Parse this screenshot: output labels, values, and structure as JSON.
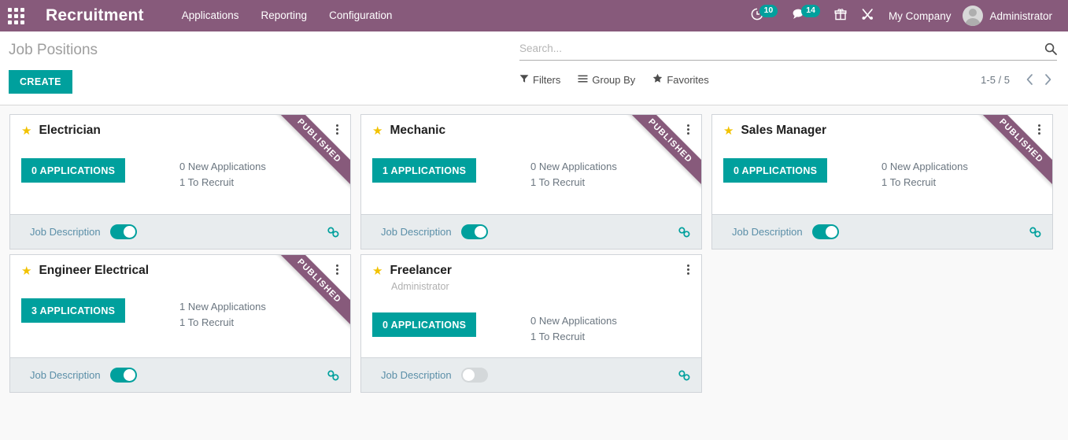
{
  "navbar": {
    "apps_icon": "apps-grid-icon",
    "brand": "Recruitment",
    "menu_items": [
      {
        "label": "Applications"
      },
      {
        "label": "Reporting"
      },
      {
        "label": "Configuration"
      }
    ],
    "systray": {
      "activities": {
        "icon": "clock-icon",
        "count": "10"
      },
      "messages": {
        "icon": "chat-bubble-icon",
        "count": "14"
      },
      "gift": {
        "icon": "gift-icon"
      },
      "tools": {
        "icon": "wrench-screwdriver-icon"
      },
      "company": "My Company",
      "user": "Administrator"
    }
  },
  "control_panel": {
    "breadcrumb": "Job Positions",
    "create_label": "CREATE",
    "search": {
      "placeholder": "Search...",
      "value": "",
      "icon": "search-icon"
    },
    "filters": [
      {
        "label": "Filters",
        "icon": "filter-icon"
      },
      {
        "label": "Group By",
        "icon": "list-icon"
      },
      {
        "label": "Favorites",
        "icon": "star-icon"
      }
    ],
    "pager": {
      "count": "1-5 / 5",
      "prev_icon": "chevron-left-icon",
      "next_icon": "chevron-right-icon"
    }
  },
  "kanban": {
    "ribbon_label": "PUBLISHED",
    "footer_toggle_label": "Job Description",
    "cards": [
      {
        "title": "Electrician",
        "subtitle": "",
        "starred": true,
        "published": true,
        "applications_button": "0 APPLICATIONS",
        "new_applications": "0 New Applications",
        "to_recruit": "1 To Recruit",
        "job_description_on": true
      },
      {
        "title": "Mechanic",
        "subtitle": "",
        "starred": true,
        "published": true,
        "applications_button": "1 APPLICATIONS",
        "new_applications": "0 New Applications",
        "to_recruit": "1 To Recruit",
        "job_description_on": true
      },
      {
        "title": "Sales Manager",
        "subtitle": "",
        "starred": true,
        "published": true,
        "applications_button": "0 APPLICATIONS",
        "new_applications": "0 New Applications",
        "to_recruit": "1 To Recruit",
        "job_description_on": true
      },
      {
        "title": "Engineer Electrical",
        "subtitle": "",
        "starred": true,
        "published": true,
        "applications_button": "3 APPLICATIONS",
        "new_applications": "1 New Applications",
        "to_recruit": "1 To Recruit",
        "job_description_on": true
      },
      {
        "title": "Freelancer",
        "subtitle": "Administrator",
        "starred": true,
        "published": false,
        "applications_button": "0 APPLICATIONS",
        "new_applications": "0 New Applications",
        "to_recruit": "1 To Recruit",
        "job_description_on": false
      }
    ]
  },
  "colors": {
    "brand_purple": "#875A7B",
    "accent_teal": "#00A09D",
    "star_gold": "#f2c200",
    "footer_grey": "#e8ecee",
    "page_bg": "#f9f9f9"
  }
}
